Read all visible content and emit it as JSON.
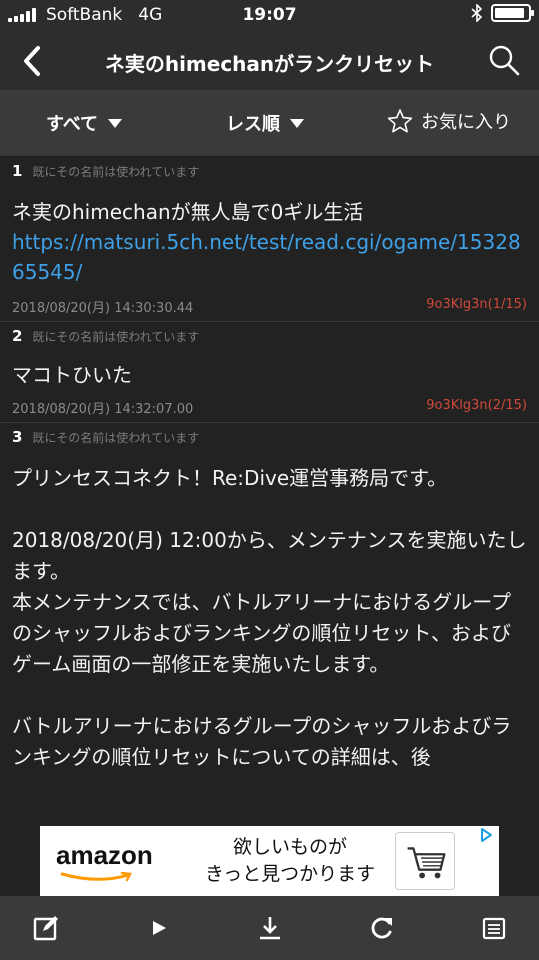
{
  "status": {
    "carrier": "SoftBank",
    "network": "4G",
    "time": "19:07",
    "bluetooth_icon": "bluetooth-icon",
    "battery_level": 0.9
  },
  "nav": {
    "title": "ネ実のhimechanがランクリセット",
    "back_icon": "chevron-left-icon",
    "search_icon": "search-icon"
  },
  "filters": {
    "all_label": "すべて",
    "order_label": "レス順",
    "favorite_label": "お気に入り"
  },
  "posts": [
    {
      "number": "1",
      "name": "既にその名前は使われています",
      "text": "ネ実のhimechanが無人島で0ギル生活",
      "link": "https://matsuri.5ch.net/test/read.cgi/ogame/1532865545/",
      "date": "2018/08/20(月) 14:30:30.44",
      "id": "9o3Klg3n(1/15)"
    },
    {
      "number": "2",
      "name": "既にその名前は使われています",
      "text": "マコトひいた",
      "date": "2018/08/20(月) 14:32:07.00",
      "id": "9o3Klg3n(2/15)"
    },
    {
      "number": "3",
      "name": "既にその名前は使われています",
      "text": "プリンセスコネクト！Re:Dive運営事務局です。\n\n2018/08/20(月) 12:00から、メンテナンスを実施いたします。\n本メンテナンスでは、バトルアリーナにおけるグループのシャッフルおよびランキングの順位リセット、およびゲーム画面の一部修正を実施いたします。\n\nバトルアリーナにおけるグループのシャッフルおよびランキングの順位リセットについての詳細は、後"
    }
  ],
  "ad": {
    "brand": "amazon",
    "line1": "欲しいものが",
    "line2": "きっと見つかります",
    "accent": "#ff9900"
  },
  "toolbar": {
    "icons": [
      "compose-icon",
      "play-icon",
      "download-icon",
      "refresh-icon",
      "menu-icon"
    ]
  }
}
